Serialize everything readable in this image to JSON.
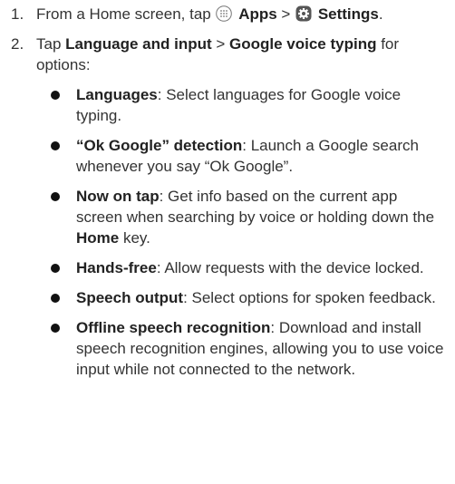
{
  "steps": [
    {
      "number": "1.",
      "text_before": "From a Home screen, tap ",
      "apps_icon": "apps-grid-icon",
      "apps_label": "Apps",
      "separator": " > ",
      "settings_icon": "settings-gear-icon",
      "settings_label": "Settings",
      "end": "."
    },
    {
      "number": "2.",
      "text_before": "Tap ",
      "bold_1": "Language and input",
      "separator": " > ",
      "bold_2": "Google voice typing",
      "text_after": " for options:"
    }
  ],
  "options": [
    {
      "title": "Languages",
      "desc": ": Select languages for Google voice typing."
    },
    {
      "title": "“Ok Google” detection",
      "desc": ": Launch a Google search whenever you say “Ok Google”."
    },
    {
      "title": "Now on tap",
      "desc": ": Get info based on the current app screen when searching by voice or holding down the ",
      "key": "Home",
      "desc_end": " key."
    },
    {
      "title": "Hands-free",
      "desc": ": Allow requests with the device locked."
    },
    {
      "title": "Speech output",
      "desc": ": Select options for spoken feedback."
    },
    {
      "title": "Offline speech recognition",
      "desc": ": Download and install speech recognition engines, allowing you to use voice input while not connected to the network."
    }
  ]
}
